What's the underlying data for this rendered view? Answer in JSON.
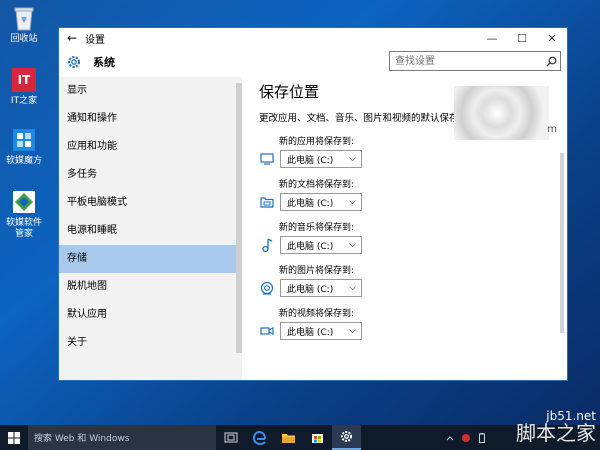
{
  "desktop": {
    "icons": [
      {
        "label": "回收站"
      },
      {
        "label": "IT之家",
        "logo_text": "IT"
      },
      {
        "label": "软媒魔方"
      },
      {
        "label": "软媒软件管家"
      }
    ]
  },
  "window": {
    "title": "设置",
    "section": "系统",
    "search_placeholder": "查找设置",
    "sidebar": [
      {
        "label": "显示"
      },
      {
        "label": "通知和操作"
      },
      {
        "label": "应用和功能"
      },
      {
        "label": "多任务"
      },
      {
        "label": "平板电脑模式"
      },
      {
        "label": "电源和睡眠"
      },
      {
        "label": "存储",
        "active": true
      },
      {
        "label": "脱机地图"
      },
      {
        "label": "默认应用"
      },
      {
        "label": "关于"
      }
    ],
    "content": {
      "heading": "保存位置",
      "description": "更改应用、文档、音乐、图片和视频的默认保存位",
      "thumb_suffix": "m",
      "groups": [
        {
          "label": "新的应用将保存到:",
          "value": "此电脑 (C:)",
          "icon": "monitor-icon"
        },
        {
          "label": "新的文档将保存到:",
          "value": "此电脑 (C:)",
          "icon": "folder-icon"
        },
        {
          "label": "新的音乐将保存到:",
          "value": "此电脑 (C:)",
          "icon": "music-note-icon"
        },
        {
          "label": "新的图片将保存到:",
          "value": "此电脑 (C:)",
          "icon": "camera-icon"
        },
        {
          "label": "新的视频将保存到:",
          "value": "此电脑 (C:)",
          "icon": "video-icon"
        }
      ]
    }
  },
  "taskbar": {
    "search_text": "搜索 Web 和 Windows"
  },
  "watermark": {
    "line1": "jb51.net",
    "line2": "脚本之家"
  },
  "colors": {
    "accent": "#0a63c0",
    "selection": "#a9c9ec",
    "taskbar": "#0f1a2b"
  }
}
